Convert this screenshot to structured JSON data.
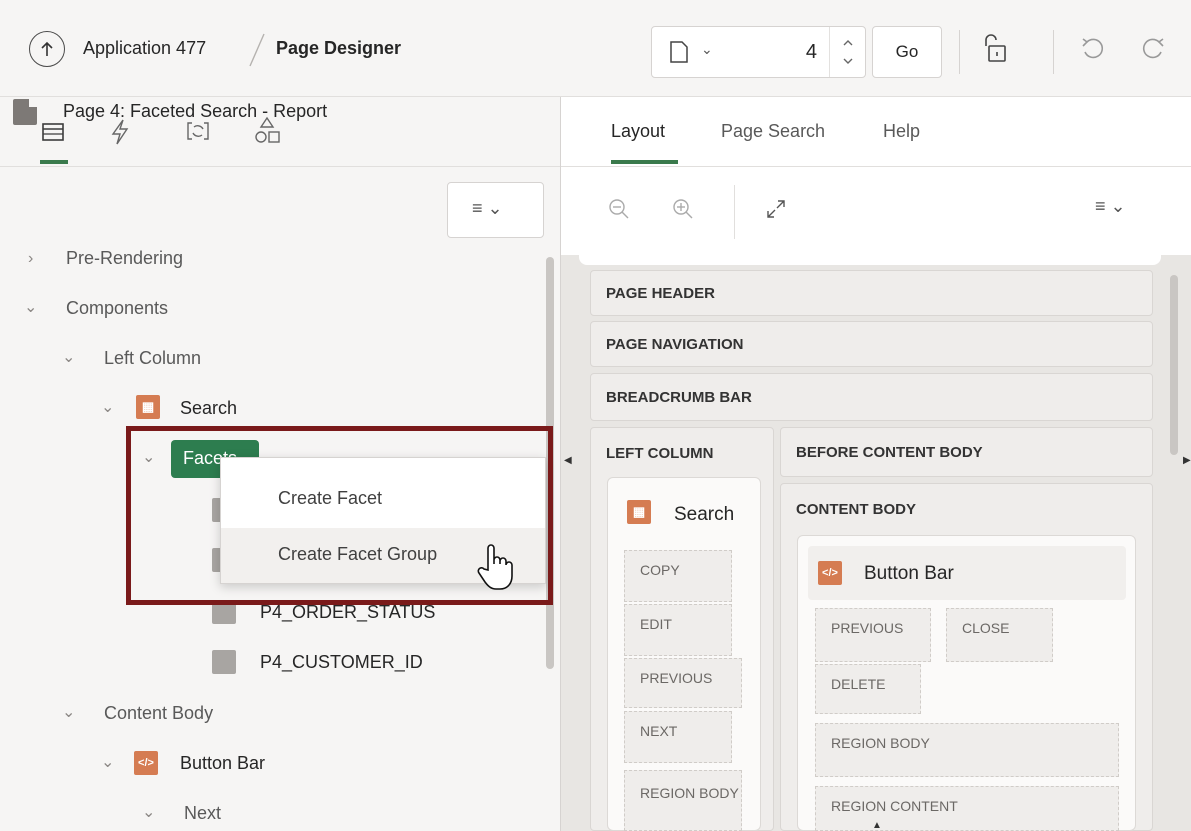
{
  "header": {
    "app_crumb": "Application 477",
    "page_crumb": "Page Designer",
    "page_number": "4",
    "go_label": "Go"
  },
  "left": {
    "tree_title": "Page 4: Faceted Search - Report",
    "nodes": {
      "pre_rendering": "Pre-Rendering",
      "components": "Components",
      "left_column": "Left Column",
      "search": "Search",
      "facets": "Facets",
      "order_status": "P4_ORDER_STATUS",
      "customer_id": "P4_CUSTOMER_ID",
      "content_body": "Content Body",
      "button_bar": "Button Bar",
      "next": "Next"
    },
    "context_menu": [
      "Create Facet",
      "Create Facet Group"
    ]
  },
  "right": {
    "tabs": [
      "Layout",
      "Page Search",
      "Help"
    ],
    "bands": {
      "page_header": "PAGE HEADER",
      "page_navigation": "PAGE NAVIGATION",
      "breadcrumb_bar": "BREADCRUMB BAR",
      "left_column": "LEFT COLUMN",
      "before_content_body": "BEFORE CONTENT BODY",
      "content_body": "CONTENT BODY"
    },
    "search_card": {
      "title": "Search",
      "slots": [
        "COPY",
        "EDIT",
        "PREVIOUS",
        "NEXT",
        "REGION BODY"
      ]
    },
    "button_bar_card": {
      "title": "Button Bar",
      "slots": [
        "PREVIOUS",
        "CLOSE",
        "DELETE",
        "REGION BODY",
        "REGION CONTENT"
      ]
    }
  }
}
